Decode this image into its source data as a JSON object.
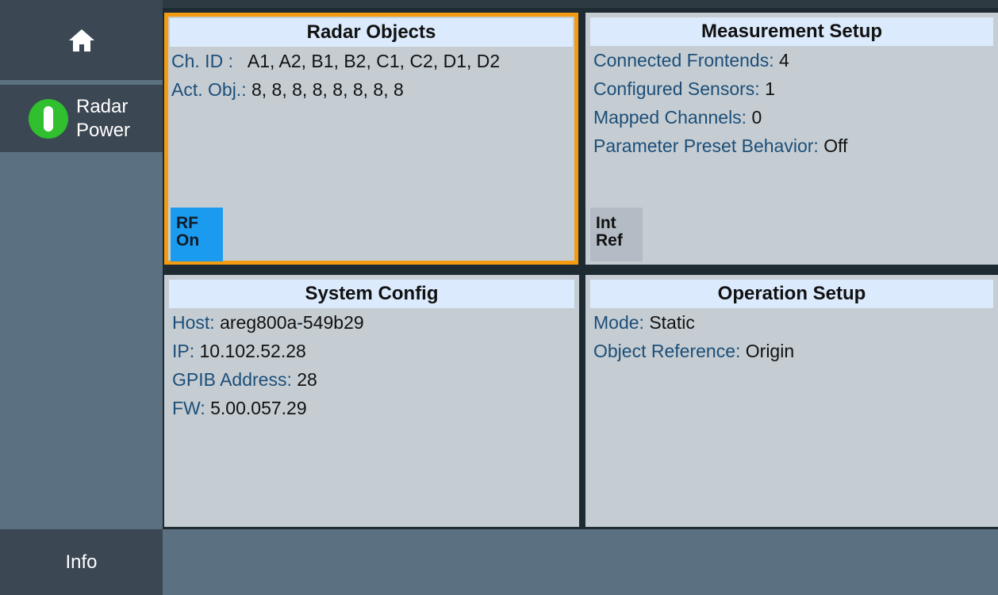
{
  "sidebar": {
    "home_icon": "home-icon",
    "radar_power": {
      "label_line1": "Radar",
      "label_line2": "Power",
      "state_color": "#2fbf2f"
    },
    "info_label": "Info"
  },
  "panels": {
    "radar_objects": {
      "title": "Radar Objects",
      "rows": [
        {
          "label": "Ch. ID :",
          "value": "A1, A2, B1, B2, C1, C2, D1, D2"
        },
        {
          "label": "Act. Obj.:",
          "value": "8, 8, 8, 8, 8, 8, 8, 8"
        }
      ],
      "badge_line1": "RF",
      "badge_line2": "On"
    },
    "measurement_setup": {
      "title": "Measurement Setup",
      "rows": [
        {
          "label": "Connected Frontends:",
          "value": "4"
        },
        {
          "label": "Configured Sensors:",
          "value": "1"
        },
        {
          "label": "Mapped Channels:",
          "value": "0"
        },
        {
          "label": "Parameter Preset Behavior:",
          "value": "Off"
        }
      ],
      "badge_line1": "Int",
      "badge_line2": "Ref"
    },
    "system_config": {
      "title": "System Config",
      "rows": [
        {
          "label": "Host:",
          "value": "areg800a-549b29"
        },
        {
          "label": "IP:",
          "value": "10.102.52.28"
        },
        {
          "label": "GPIB Address:",
          "value": "28"
        },
        {
          "label": "FW:",
          "value": "5.00.057.29"
        }
      ]
    },
    "operation_setup": {
      "title": "Operation Setup",
      "rows": [
        {
          "label": "Mode:",
          "value": "Static"
        },
        {
          "label": "Object Reference:",
          "value": "Origin"
        }
      ]
    }
  },
  "colors": {
    "accent_selected": "#f39c12",
    "label_blue": "#1c4e78",
    "rf_on": "#1a9bf0"
  }
}
